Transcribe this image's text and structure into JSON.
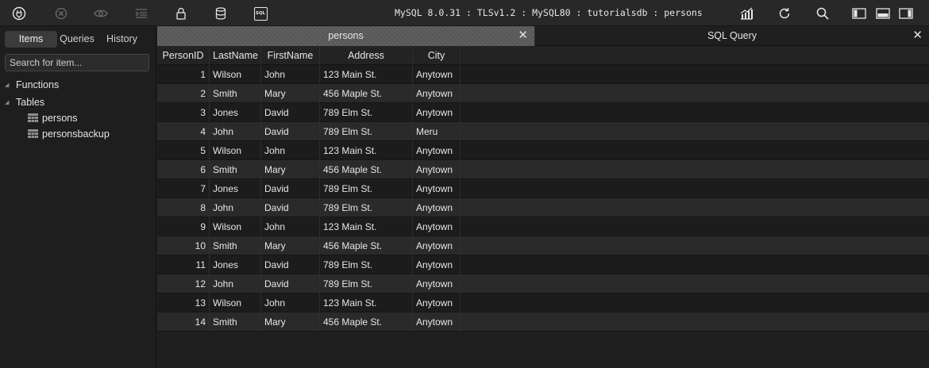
{
  "toolbar": {
    "connection_info": "MySQL 8.0.31 : TLSv1.2 : MySQL80 : tutorialsdb : persons",
    "sql_icon_text": "SQL",
    "icons": [
      "plug-icon",
      "stop-icon",
      "eye-icon",
      "indent-icon",
      "lock-icon",
      "database-icon",
      "sql-icon",
      "chart-icon",
      "refresh-icon",
      "search-icon",
      "left-panel-icon",
      "bottom-panel-icon",
      "right-panel-icon"
    ]
  },
  "sidebar": {
    "tabs": [
      "Items",
      "Queries",
      "History"
    ],
    "active_tab": "Items",
    "search_placeholder": "Search for item...",
    "groups": {
      "functions": "Functions",
      "tables": "Tables"
    },
    "tables": [
      "persons",
      "personsbackup"
    ]
  },
  "tabs": [
    {
      "label": "persons",
      "active": true
    },
    {
      "label": "SQL Query",
      "active": false
    }
  ],
  "grid": {
    "columns": [
      "PersonID",
      "LastName",
      "FirstName",
      "Address",
      "City"
    ],
    "rows": [
      [
        "1",
        "Wilson",
        "John",
        "123 Main St.",
        "Anytown"
      ],
      [
        "2",
        "Smith",
        "Mary",
        "456 Maple St.",
        "Anytown"
      ],
      [
        "3",
        "Jones",
        "David",
        "789 Elm St.",
        "Anytown"
      ],
      [
        "4",
        "John",
        "David",
        "789 Elm St.",
        "Meru"
      ],
      [
        "5",
        "Wilson",
        "John",
        "123 Main St.",
        "Anytown"
      ],
      [
        "6",
        "Smith",
        "Mary",
        "456 Maple St.",
        "Anytown"
      ],
      [
        "7",
        "Jones",
        "David",
        "789 Elm St.",
        "Anytown"
      ],
      [
        "8",
        "John",
        "David",
        "789 Elm St.",
        "Anytown"
      ],
      [
        "9",
        "Wilson",
        "John",
        "123 Main St.",
        "Anytown"
      ],
      [
        "10",
        "Smith",
        "Mary",
        "456 Maple St.",
        "Anytown"
      ],
      [
        "11",
        "Jones",
        "David",
        "789 Elm St.",
        "Anytown"
      ],
      [
        "12",
        "John",
        "David",
        "789 Elm St.",
        "Anytown"
      ],
      [
        "13",
        "Wilson",
        "John",
        "123 Main St.",
        "Anytown"
      ],
      [
        "14",
        "Smith",
        "Mary",
        "456 Maple St.",
        "Anytown"
      ]
    ]
  },
  "colors": {
    "background": "#1e1e1e",
    "toolbar": "#282828",
    "active_tab": "#5a5a5a",
    "row_alt": "#2a2a2a"
  }
}
